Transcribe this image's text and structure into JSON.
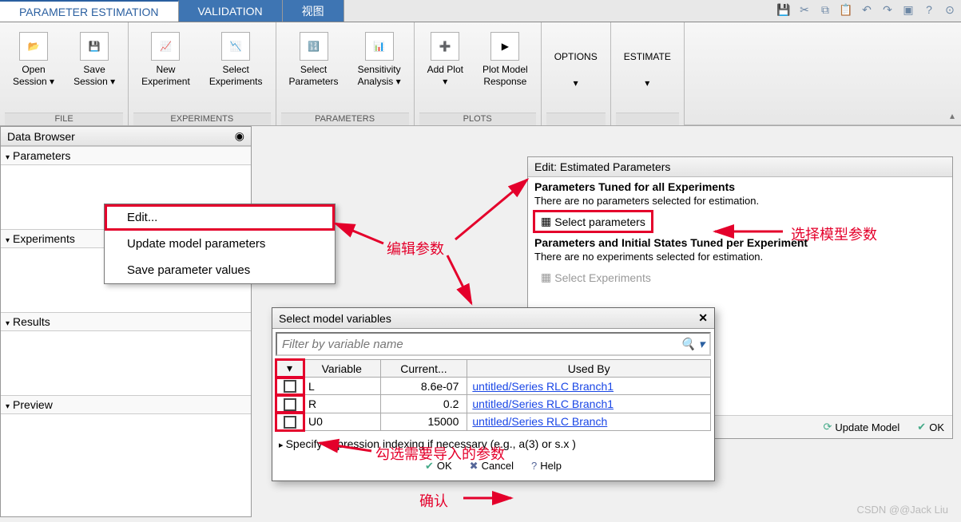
{
  "tabs": {
    "t0": "PARAMETER ESTIMATION",
    "t1": "VALIDATION",
    "t2": "视图"
  },
  "ribbon": {
    "file": {
      "label": "FILE",
      "open": "Open\nSession ▾",
      "save": "Save\nSession ▾"
    },
    "exp": {
      "label": "EXPERIMENTS",
      "new": "New\nExperiment",
      "select": "Select\nExperiments"
    },
    "par": {
      "label": "PARAMETERS",
      "select": "Select\nParameters",
      "sens": "Sensitivity\nAnalysis ▾"
    },
    "plot": {
      "label": "PLOTS",
      "add": "Add Plot\n▾",
      "resp": "Plot Model\nResponse"
    },
    "options": "OPTIONS",
    "estimate": "ESTIMATE"
  },
  "db": {
    "title": "Data Browser",
    "s1": "Parameters",
    "s2": "Experiments",
    "s3": "Results",
    "s4": "Preview"
  },
  "ctx": {
    "edit": "Edit...",
    "update": "Update model parameters",
    "save": "Save parameter values"
  },
  "est": {
    "title": "Edit: Estimated Parameters",
    "h1": "Parameters Tuned for all Experiments",
    "n1": "There are no parameters selected for estimation.",
    "a1": "Select parameters",
    "h2": "Parameters and Initial States Tuned per Experiment",
    "n2": "There are no experiments selected for estimation.",
    "a2": "Select Experiments",
    "update": "Update Model",
    "ok": "OK"
  },
  "dlg": {
    "title": "Select model variables",
    "filter_ph": "Filter by variable name",
    "cols": {
      "var": "Variable",
      "cur": "Current...",
      "used": "Used By"
    },
    "rows": [
      {
        "var": "L",
        "cur": "8.6e-07",
        "used": "untitled/Series RLC Branch1"
      },
      {
        "var": "R",
        "cur": "0.2",
        "used": "untitled/Series RLC Branch1"
      },
      {
        "var": "U0",
        "cur": "15000",
        "used": "untitled/Series RLC Branch"
      }
    ],
    "expand": "Specify expression indexing if necessary (e.g., a(3) or s.x )",
    "ok": "OK",
    "cancel": "Cancel",
    "help": "Help"
  },
  "anno": {
    "a1": "编辑参数",
    "a2": "选择模型参数",
    "a3": "勾选需要导入的参数",
    "a4": "确认"
  },
  "watermark": "CSDN @@Jack Liu"
}
